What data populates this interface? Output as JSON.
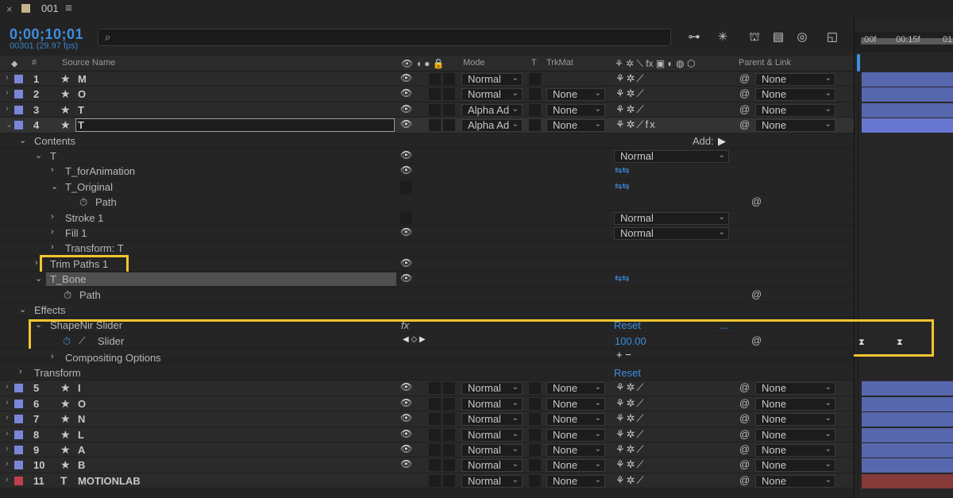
{
  "tab": {
    "close": "×",
    "name": "001",
    "menu": "≡"
  },
  "header": {
    "timecode": "0;00;10;01",
    "fps": "00301 (29.97 fps)",
    "search_icon": "⌕"
  },
  "columns": {
    "name": "Source Name",
    "num": "#",
    "mode": "Mode",
    "t": "T",
    "trkmat": "TrkMat",
    "parent": "Parent & Link"
  },
  "timeline": {
    "tick1": ":00f",
    "tick2": "00:15f",
    "tick3": "01"
  },
  "layers_top": [
    {
      "num": "1",
      "name": "M",
      "mode": "Normal",
      "trkmat": "",
      "parent": "None",
      "color": "#7a86d8"
    },
    {
      "num": "2",
      "name": "O",
      "mode": "Normal",
      "trkmat": "None",
      "parent": "None",
      "color": "#7a86d8"
    },
    {
      "num": "3",
      "name": "T",
      "mode": "Alpha Ad",
      "trkmat": "None",
      "parent": "None",
      "color": "#7a86d8"
    },
    {
      "num": "4",
      "name": "T",
      "mode": "Alpha Ad",
      "trkmat": "None",
      "parent": "None",
      "color": "#7a86d8"
    }
  ],
  "props": {
    "contents": "Contents",
    "add": "Add:",
    "t_group": "T",
    "t_group_mode": "Normal",
    "t_forAnimation": "T_forAnimation",
    "t_original": "T_Original",
    "path1": "Path",
    "stroke1": "Stroke 1",
    "stroke1_mode": "Normal",
    "fill1": "Fill 1",
    "fill1_mode": "Normal",
    "transform_t": "Transform: T",
    "trim_paths": "Trim Paths 1",
    "t_bone": "T_Bone",
    "path2": "Path",
    "effects": "Effects",
    "slider_effect": "ShapeNir Slider",
    "fx": "fx",
    "reset1": "Reset",
    "dots": "...",
    "slider": "Slider",
    "slider_value": "100.00",
    "compositing": "Compositing Options",
    "plusminus": "+ −",
    "transform": "Transform",
    "reset2": "Reset"
  },
  "layers_bottom": [
    {
      "num": "5",
      "name": "I",
      "mode": "Normal",
      "trkmat": "None",
      "parent": "None",
      "color": "#7a86d8"
    },
    {
      "num": "6",
      "name": "O",
      "mode": "Normal",
      "trkmat": "None",
      "parent": "None",
      "color": "#7a86d8"
    },
    {
      "num": "7",
      "name": "N",
      "mode": "Normal",
      "trkmat": "None",
      "parent": "None",
      "color": "#7a86d8"
    },
    {
      "num": "8",
      "name": "L",
      "mode": "Normal",
      "trkmat": "None",
      "parent": "None",
      "color": "#7a86d8"
    },
    {
      "num": "9",
      "name": "A",
      "mode": "Normal",
      "trkmat": "None",
      "parent": "None",
      "color": "#7a86d8"
    },
    {
      "num": "10",
      "name": "B",
      "mode": "Normal",
      "trkmat": "None",
      "parent": "None",
      "color": "#7a86d8"
    },
    {
      "num": "11",
      "name": "MOTIONLAB",
      "mode": "Normal",
      "trkmat": "None",
      "parent": "None",
      "color": "#c0404a"
    }
  ],
  "colors": {
    "accent": "#3d8ee0",
    "highlight": "#f2c531",
    "bar": "#5a6ab5",
    "bar_red": "#8a3a3a"
  }
}
